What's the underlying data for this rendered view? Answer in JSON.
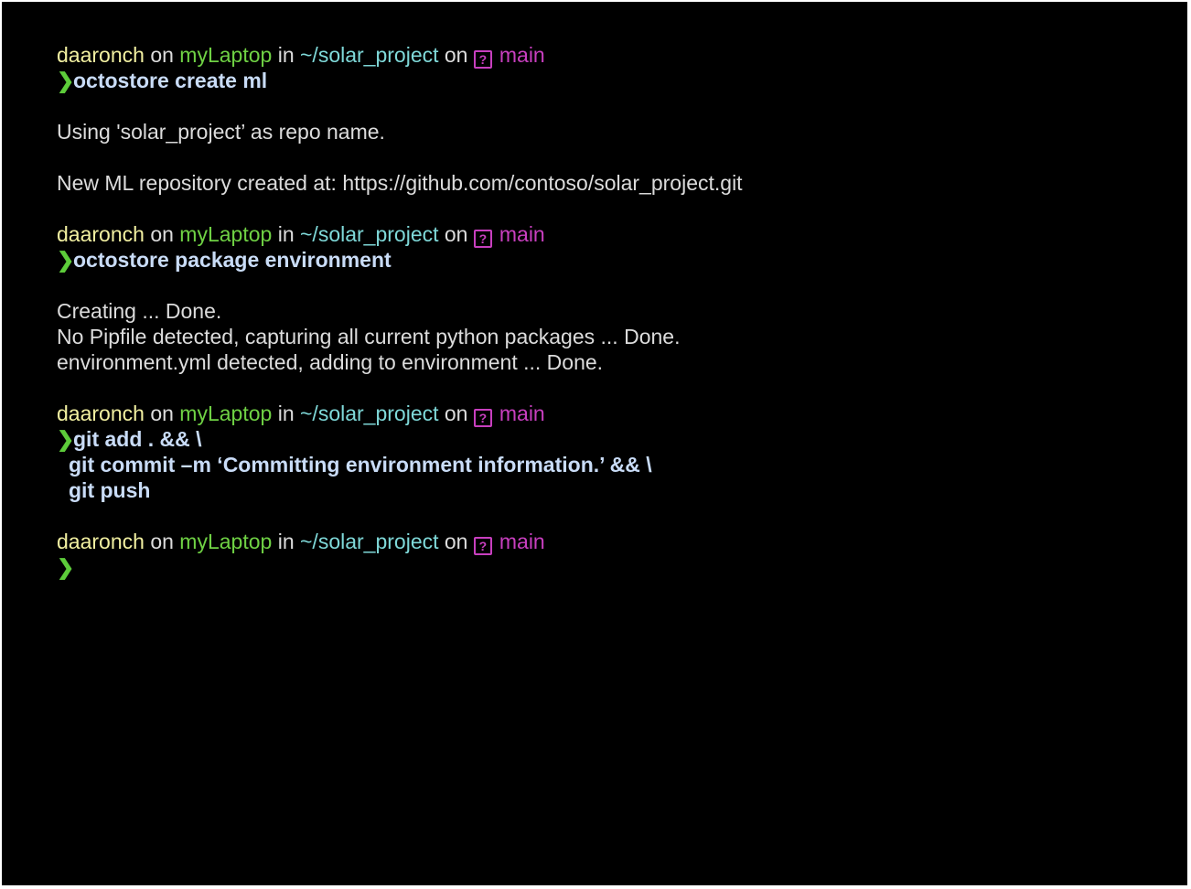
{
  "prompt": {
    "user": "daaronch",
    "on1": "on",
    "host": "myLaptop",
    "in": "in",
    "dir": "~/solar_project",
    "on2": "on",
    "git_icon_glyph": "?",
    "branch": "main",
    "chevron": "❯"
  },
  "blocks": [
    {
      "command": [
        "octostore create ml"
      ],
      "output": [
        "Using 'solar_project’ as repo name.",
        "",
        "New ML repository created at: https://github.com/contoso/solar_project.git"
      ]
    },
    {
      "command": [
        "octostore package environment"
      ],
      "output": [
        "Creating ... Done.",
        "No Pipfile detected, capturing all current python packages ... Done.",
        "environment.yml detected, adding to environment ... Done."
      ]
    },
    {
      "command": [
        "git add . && \\",
        "git commit –m ‘Committing environment information.’ && \\",
        "git push"
      ],
      "output": []
    }
  ],
  "colors": {
    "background": "#000000",
    "user": "#f2f0a1",
    "host": "#6fd144",
    "dir": "#7fd9d9",
    "branch": "#c83fbf",
    "command": "#c9dcf7",
    "output": "#dcdcdc",
    "chevron": "#5dcc3a"
  }
}
